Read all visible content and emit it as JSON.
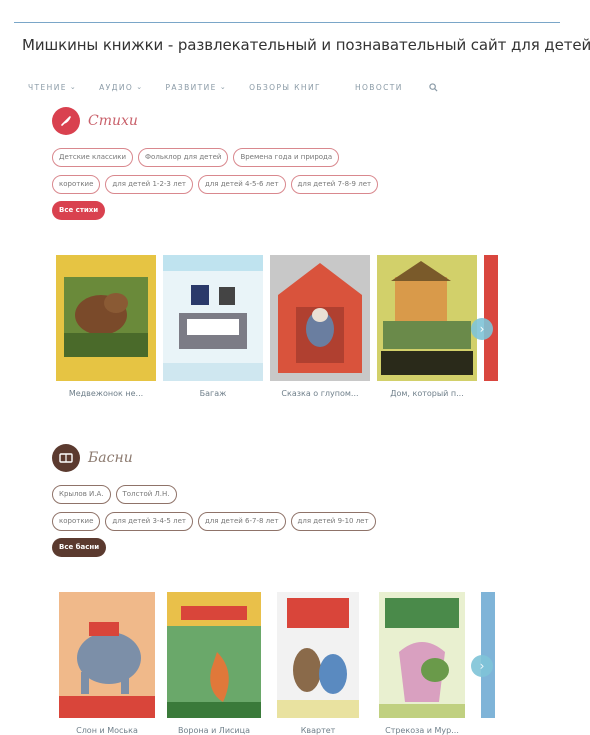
{
  "site": {
    "title": "Мишкины книжки - развлекательный и познавательный сайт для детей."
  },
  "nav": {
    "items": [
      "ЧТЕНИЕ",
      "АУДИО",
      "РАЗВИТИЕ",
      "ОБЗОРЫ КНИГ",
      "НОВОСТИ"
    ],
    "has_caret": [
      true,
      true,
      true,
      false,
      false
    ]
  },
  "sections": [
    {
      "title": "Стихи",
      "accent": "#d9414f",
      "tag_rows": [
        [
          "Детские классики",
          "Фольклор для детей",
          "Времена года и природа"
        ],
        [
          "короткие",
          "для детей 1-2-3 лет",
          "для детей 4-5-6 лет",
          "для детей 7-8-9 лет"
        ]
      ],
      "all_label": "Все стихи",
      "books": [
        "Медвежонок не...",
        "Багаж",
        "Сказка о глупом...",
        "Дом, который п..."
      ]
    },
    {
      "title": "Басни",
      "accent": "#5b3a2f",
      "tag_rows": [
        [
          "Крылов И.А.",
          "Толстой Л.Н."
        ],
        [
          "короткие",
          "для детей 3-4-5 лет",
          "для детей 6-7-8 лет",
          "для детей 9-10 лет"
        ]
      ],
      "all_label": "Все басни",
      "books": [
        "Слон и Моська",
        "Ворона и Лисица",
        "Квартет",
        "Стрекоза и Мур..."
      ]
    }
  ]
}
